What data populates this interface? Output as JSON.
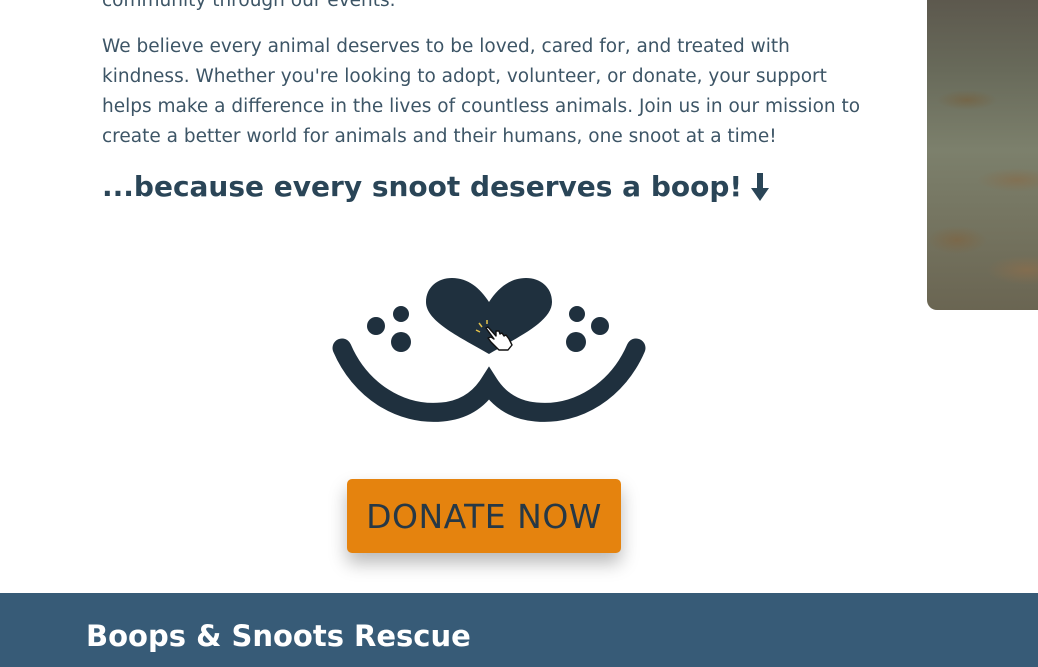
{
  "content": {
    "intro_cut": "community through our events.",
    "intro": "We believe every animal deserves to be loved, cared for, and treated with kindness. Whether you're looking to adopt, volunteer, or donate, your support helps make a difference in the lives of countless animals. Join us in our mission to create a better world for animals and their humans, one snoot at a time!",
    "tagline": "...because every snoot deserves a boop!"
  },
  "icons": {
    "tagline_arrow": "arrow-down-icon",
    "logo": "snoot-boop-logo",
    "cursor": "hand-pointer-icon"
  },
  "donate": {
    "label": "DONATE NOW"
  },
  "footer": {
    "title": "Boops & Snoots Rescue"
  },
  "colors": {
    "text": "#3d5566",
    "heading": "#2a4557",
    "logo": "#1f303e",
    "button": "#e5830e",
    "button_text": "#263846",
    "footer_bg": "#375b77",
    "footer_text": "#ffffff"
  }
}
